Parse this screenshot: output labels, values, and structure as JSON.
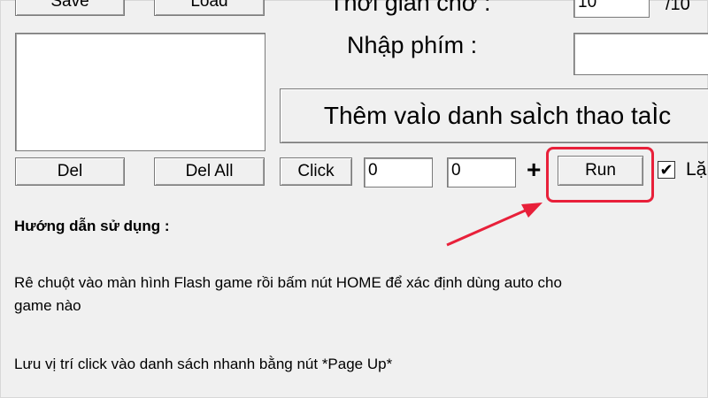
{
  "toolbar": {
    "save_label": "Save",
    "load_label": "Load",
    "del_label": "Del",
    "del_all_label": "Del All",
    "click_label": "Click",
    "run_label": "Run",
    "add_action_label": "Thêm vaÌo danh saÌch thao taÌc"
  },
  "settings": {
    "wait_time_label": "Thời gian chờ :",
    "wait_time_value": "10",
    "wait_time_unit": "/10",
    "key_input_label": "Nhập phím :",
    "key_input_value": "",
    "x_value": "0",
    "y_value": "0",
    "plus_symbol": "+",
    "checkbox_label": "Lặ",
    "checkbox_checked": true
  },
  "instructions": {
    "heading": "Hướng dẫn sử dụng :",
    "line1": "Rê chuột vào màn hình Flash game rồi bấm nút HOME để xác định dùng auto cho",
    "line2": "game nào",
    "line3": "Lưu vị trí click vào danh sách nhanh bằng nút *Page Up*"
  },
  "colors": {
    "highlight": "#e8203a",
    "background": "#f0f0f0"
  }
}
